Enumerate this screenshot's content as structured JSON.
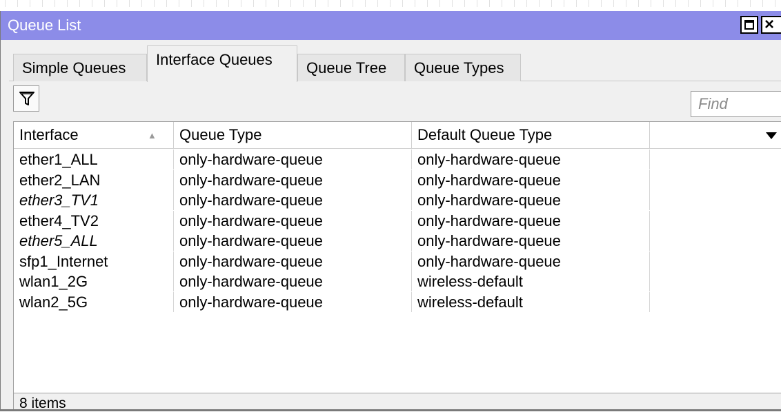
{
  "window": {
    "title": "Queue List"
  },
  "tabs": [
    {
      "label": "Simple Queues",
      "active": false
    },
    {
      "label": "Interface Queues",
      "active": true
    },
    {
      "label": "Queue Tree",
      "active": false
    },
    {
      "label": "Queue Types",
      "active": false
    }
  ],
  "toolbar": {
    "filter_icon": "filter-icon",
    "find_placeholder": "Find"
  },
  "table": {
    "columns": [
      "Interface",
      "Queue Type",
      "Default Queue Type",
      ""
    ],
    "sorted_column": "Interface",
    "rows": [
      {
        "interface": "ether1_ALL",
        "queue_type": "only-hardware-queue",
        "default_queue_type": "only-hardware-queue",
        "italic": false
      },
      {
        "interface": "ether2_LAN",
        "queue_type": "only-hardware-queue",
        "default_queue_type": "only-hardware-queue",
        "italic": false
      },
      {
        "interface": "ether3_TV1",
        "queue_type": "only-hardware-queue",
        "default_queue_type": "only-hardware-queue",
        "italic": true
      },
      {
        "interface": "ether4_TV2",
        "queue_type": "only-hardware-queue",
        "default_queue_type": "only-hardware-queue",
        "italic": false
      },
      {
        "interface": "ether5_ALL",
        "queue_type": "only-hardware-queue",
        "default_queue_type": "only-hardware-queue",
        "italic": true
      },
      {
        "interface": "sfp1_Internet",
        "queue_type": "only-hardware-queue",
        "default_queue_type": "only-hardware-queue",
        "italic": false
      },
      {
        "interface": "wlan1_2G",
        "queue_type": "only-hardware-queue",
        "default_queue_type": "wireless-default",
        "italic": false
      },
      {
        "interface": "wlan2_5G",
        "queue_type": "only-hardware-queue",
        "default_queue_type": "wireless-default",
        "italic": false
      }
    ]
  },
  "status": {
    "item_count": "8 items"
  },
  "colors": {
    "titlebar": "#8c8ce8",
    "window_bg": "#f0f0f0",
    "grid_bg": "#ffffff"
  }
}
